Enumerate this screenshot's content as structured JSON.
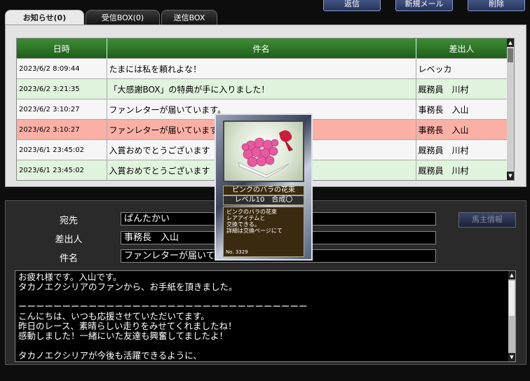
{
  "toolbar": {
    "reply_label": "返信",
    "new_label": "新規メール",
    "delete_label": "削除"
  },
  "tabs": [
    {
      "label": "お知らせ(0)"
    },
    {
      "label": "受信BOX(0)"
    },
    {
      "label": "送信BOX"
    }
  ],
  "table": {
    "headers": [
      "日時",
      "件名",
      "差出人"
    ],
    "rows": [
      {
        "date": "2023/6/2 8:09:44",
        "subject": "たまには私を頼れよな！",
        "sender": "レベッカ"
      },
      {
        "date": "2023/6/2 3:21:35",
        "subject": "「大感謝BOX」の特典が手に入りました！",
        "sender": "厩務員　川村"
      },
      {
        "date": "2023/6/2 3:10:27",
        "subject": "ファンレターが届いています。",
        "sender": "事務長　入山"
      },
      {
        "date": "2023/6/2 3:10:27",
        "subject": "ファンレターが届いています。",
        "sender": "事務長　入山"
      },
      {
        "date": "2023/6/1 23:45:02",
        "subject": "入賞おめでとうございます",
        "sender": "厩務員　川村"
      },
      {
        "date": "2023/6/1 23:45:02",
        "subject": "入賞おめでとうございます",
        "sender": "厩務員　川村"
      }
    ]
  },
  "detail": {
    "to_label": "宛先",
    "to_value": "ぱんたかい",
    "from_label": "差出人",
    "from_value": "事務長　入山",
    "subject_label": "件名",
    "subject_value": "ファンレターが届いています。",
    "horse_info_button": "馬主情報",
    "body_lines": [
      "お疲れ様です。入山です。",
      "タカノエクシリアのファンから、お手紙を頂きました。",
      "",
      "ーーーーーーーーーーーーーーーーーーーーーーーーーーーーーーーーー",
      "こんにちは、いつも応援させていただいてます。",
      "昨日のレース、素晴らしい走りをみせてくれましたね！",
      "感動しました！一緒にいた友達も興奮してましたよ！",
      "",
      "タカノエクシリアが今後も活躍できるように、"
    ]
  },
  "card": {
    "name": "ピンクのバラの花束",
    "level": "レベル10　合成〇",
    "description": "ピンクのバラの花束\nレアアイテムと\n交換できる。\n詳細は交換ページにて",
    "number": "No. 3329"
  },
  "colors": {
    "header_green": "#2e7a28",
    "row_green": "#e1f4de",
    "row_selected": "#fbb0a6",
    "button_blue": "#3a4a7a"
  }
}
